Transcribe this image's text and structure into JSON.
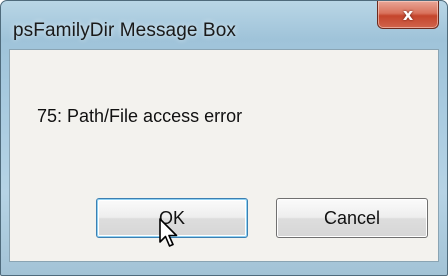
{
  "window": {
    "title": "psFamilyDir Message Box",
    "close_glyph": "x",
    "close_icon": "close-icon",
    "accent_close_color": "#c4452c",
    "frame_color": "#a9cbe0"
  },
  "dialog": {
    "message": "75: Path/File access error",
    "ok_label": "OK",
    "cancel_label": "Cancel"
  },
  "cursor": {
    "icon": "arrow-pointer-icon"
  }
}
